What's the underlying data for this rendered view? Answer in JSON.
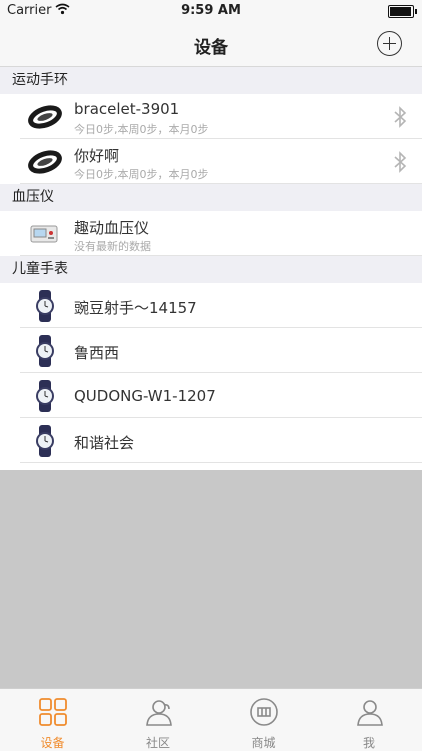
{
  "status_bar": {
    "carrier": "Carrier",
    "time": "9:59 AM",
    "battery_level": 0.95
  },
  "nav": {
    "title": "设备"
  },
  "sections": [
    {
      "title": "运动手环",
      "items": [
        {
          "name": "bracelet-3901",
          "detail": "今日0步,本周0步，本月0步",
          "icon": "bracelet-icon",
          "bluetooth": true
        },
        {
          "name": "你好啊",
          "detail": "今日0步,本周0步，本月0步",
          "icon": "bracelet-icon",
          "bluetooth": true
        }
      ]
    },
    {
      "title": "血压仪",
      "items": [
        {
          "name": "趣动血压仪",
          "detail": "没有最新的数据",
          "icon": "blood-pressure-monitor-icon",
          "bluetooth": false
        }
      ]
    },
    {
      "title": "儿童手表",
      "items": [
        {
          "name": "豌豆射手～14157",
          "icon": "watch-icon"
        },
        {
          "name": "鲁西西",
          "icon": "watch-icon"
        },
        {
          "name": "QUDONG-W1-1207",
          "icon": "watch-icon"
        },
        {
          "name": "和谐社会",
          "icon": "watch-icon"
        }
      ]
    }
  ],
  "tabs": [
    {
      "label": "设备",
      "icon": "device-grid-icon",
      "active": true
    },
    {
      "label": "社区",
      "icon": "community-icon",
      "active": false
    },
    {
      "label": "商城",
      "icon": "store-icon",
      "active": false
    },
    {
      "label": "我",
      "icon": "profile-icon",
      "active": false
    }
  ],
  "colors": {
    "accent": "#f08c2e",
    "section_bg": "#efeff4",
    "empty_area": "#c8c8c8"
  }
}
